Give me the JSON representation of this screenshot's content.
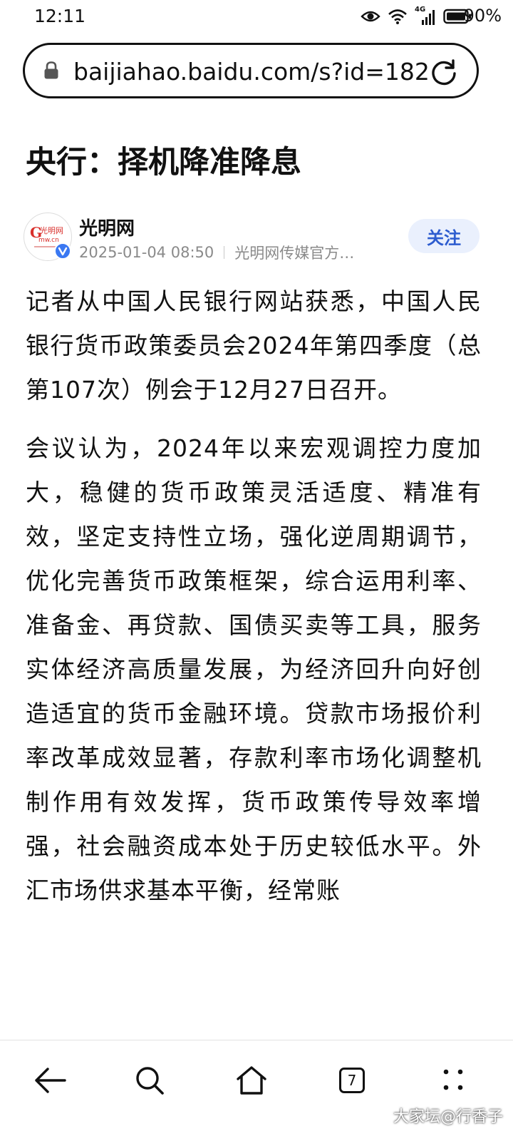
{
  "status_bar": {
    "time": "12:11",
    "network_label": "4G",
    "battery_text": "90%"
  },
  "browser": {
    "url": "baijiahao.baidu.com/s?id=182",
    "tab_count": "7"
  },
  "article": {
    "title": "央行：择机降准降息",
    "author": {
      "name": "光明网",
      "date": "2025-01-04 08:50",
      "description": "光明网传媒官方…",
      "avatar_logo_text": "光明网"
    },
    "follow_label": "关注",
    "paragraphs": [
      "记者从中国人民银行网站获悉，中国人民银行货币政策委员会2024年第四季度（总第107次）例会于12月27日召开。",
      "会议认为，2024年以来宏观调控力度加大，稳健的货币政策灵活适度、精准有效，坚定支持性立场，强化逆周期调节，优化完善货币政策框架，综合运用利率、准备金、再贷款、国债买卖等工具，服务实体经济高质量发展，为经济回升向好创造适宜的货币金融环境。贷款市场报价利率改革成效显著，存款利率市场化调整机制作用有效发挥，货币政策传导效率增强，社会融资成本处于历史较低水平。外汇市场供求基本平衡，经常账"
    ]
  },
  "watermark": "大家坛@行香子",
  "colors": {
    "follow_bg": "#eaf0fd",
    "follow_text": "#2d5ccf",
    "verified_badge": "#3a78f2",
    "logo_red": "#d9302c"
  }
}
